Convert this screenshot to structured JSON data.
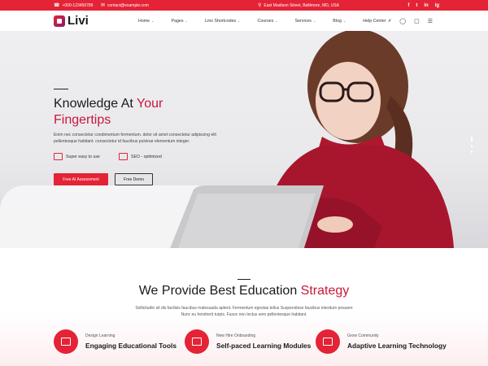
{
  "topbar": {
    "phone": "+000-123456789",
    "email": "contact@example.com",
    "address": "East Madison Street, Baltimore, MD, USA",
    "socials": [
      "f",
      "t",
      "in",
      "ig"
    ]
  },
  "nav": {
    "logo": "Livi",
    "menu": [
      "Home",
      "Pages",
      "Lms Shortcodes",
      "Courses",
      "Services",
      "Blog",
      "Help Center"
    ]
  },
  "hero": {
    "title_part1": "Knowledge At ",
    "title_accent": "Your",
    "title_part2": "Fingertips",
    "description": "Enim nec consectetur condimentum fermentum. dolor sit amet consectetur adipiscing elit pellentesque habitant. consectetur id faucibus pulvinar elementum integer.",
    "feature1": "Super easy to use",
    "feature2": "SEO - optimized",
    "primary_button": "Free AI Assessment",
    "secondary_button": "Free Demo"
  },
  "education": {
    "title_part1": "We Provide Best Education ",
    "title_accent": "Strategy",
    "description": "Sollicitudin sit dis facilisis faucibus malesuada aptent. Fermentum egestas tellus Suspendisse faucibus interdum posuere Nunc eu hendrerit turpis. Fusce non lectus sem pellentesque habitant.",
    "services": [
      {
        "kicker": "Design Learning",
        "name": "Engaging Educational Tools"
      },
      {
        "kicker": "New Hire Onboarding",
        "name": "Self-paced Learning Modules"
      },
      {
        "kicker": "Grow Community",
        "name": "Adaptive Learning Technology"
      }
    ]
  },
  "colors": {
    "accent": "#e42336",
    "accent_dark": "#c8183a"
  }
}
